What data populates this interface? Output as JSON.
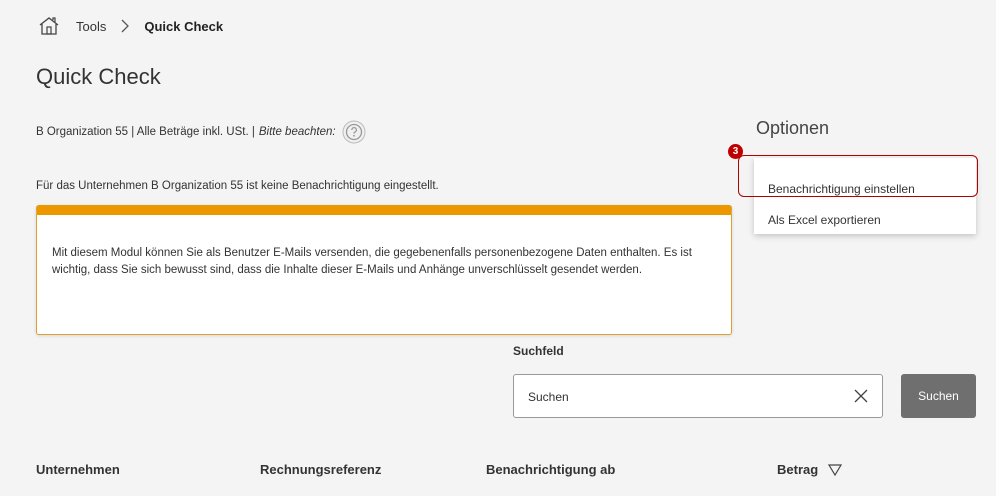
{
  "breadcrumb": {
    "home_icon": "home-icon",
    "items": [
      "Tools",
      "Quick Check"
    ]
  },
  "page": {
    "title": "Quick Check",
    "org_info": "B Organization 55 | Alle Beträge inkl. USt. |",
    "note_italic": "Bitte beachten:",
    "notice": "Für das Unternehmen B Organization 55 ist keine Benachrichtigung eingestellt."
  },
  "warning": {
    "text": "Mit diesem Modul können Sie als Benutzer E-Mails versenden, die gegebenenfalls personenbezogene Daten enthalten. Es ist wichtig, dass Sie sich bewusst sind, dass die Inhalte dieser E-Mails und Anhänge unverschlüsselt gesendet werden.",
    "accent_color": "#eb9700"
  },
  "options": {
    "title": "Optionen",
    "badge": "3",
    "badge_color": "#c00000",
    "items": [
      "Benachrichtigung einstellen",
      "Als Excel exportieren"
    ]
  },
  "search": {
    "label": "Suchfeld",
    "placeholder": "Suchen",
    "value": "",
    "button_label": "Suchen"
  },
  "table": {
    "columns": [
      "Unternehmen",
      "Rechnungsreferenz",
      "Benachrichtigung ab",
      "Betrag"
    ]
  }
}
